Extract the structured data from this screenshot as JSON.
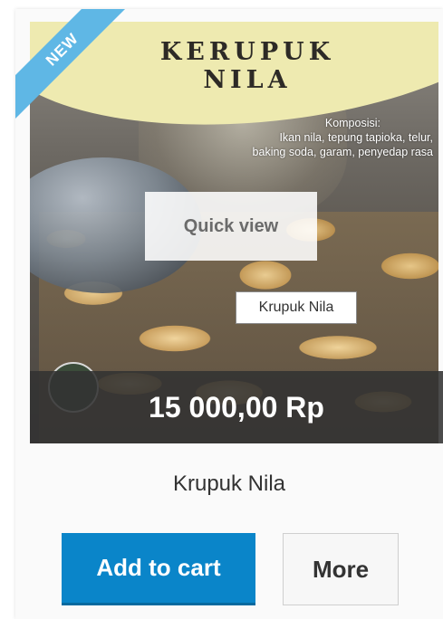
{
  "product": {
    "badge": "NEW",
    "brand_line1": "KERUPUK",
    "brand_line2": "NILA",
    "composition_title": "Komposisi:",
    "composition_line1": "Ikan nila, tepung tapioka, telur,",
    "composition_line2": "baking soda, garam, penyedap rasa",
    "quick_view_label": "Quick view",
    "tooltip_text": "Krupuk Nila",
    "price": "15 000,00 Rp",
    "name": "Krupuk Nila"
  },
  "actions": {
    "add_to_cart_label": "Add to cart",
    "more_label": "More"
  },
  "colors": {
    "ribbon": "#5fb7e5",
    "primary_button": "#0a85c9",
    "price_bar": "#323232"
  }
}
